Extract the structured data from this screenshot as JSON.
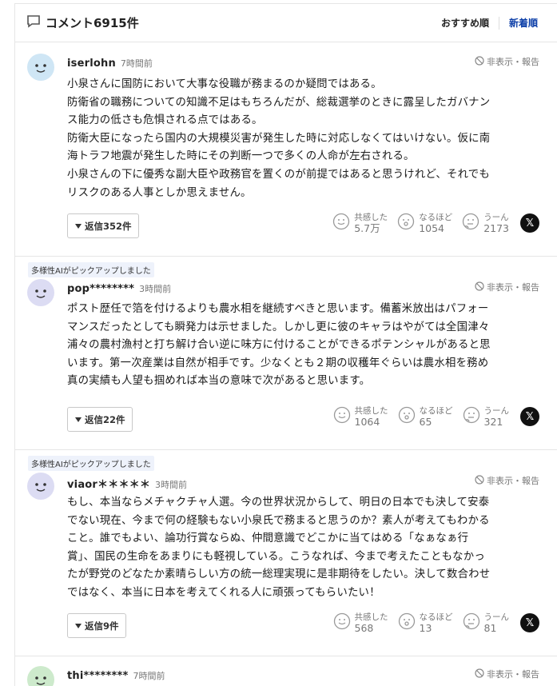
{
  "header": {
    "title": "コメント6915件",
    "sort_recommended": "おすすめ順",
    "sort_newest": "新着順"
  },
  "comments": [
    {
      "user": "iserlohn",
      "time": "7時間前",
      "hide": "非表示・報告",
      "text": "小泉さんに国防において大事な役職が務まるのか疑問ではある。\n防衛省の職務についての知識不足はもちろんだが、総裁選挙のときに露呈したガバナン\nス能力の低さも危惧される点ではある。\n防衛大臣になったら国内の大規模災害が発生した時に対応しなくてはいけない。仮に南\n海トラフ地震が発生した時にその判断一つで多くの人命が左右される。\n小泉さんの下に優秀な副大臣や政務官を置くのが前提ではあると思うけれど、それでも\nリスクのある人事としか思えません。",
      "reply": "返信352件",
      "empathy_label": "共感した",
      "empathy_count": "5.7万",
      "naruhodo_label": "なるほど",
      "naruhodo_count": "1054",
      "uun_label": "うーん",
      "uun_count": "2173",
      "avatar_color": "#cfe6f5"
    },
    {
      "badge": "多様性AIがピックアップしました",
      "user": "pop********",
      "time": "3時間前",
      "hide": "非表示・報告",
      "text": "ポスト歴任で箔を付けるよりも農水相を継続すべきと思います。備蓄米放出はパフォー\nマンスだったとしても瞬発力は示せました。しかし更に彼のキャラはやがては全国津々\n浦々の農村漁村と打ち解け合い逆に味方に付けることができるポテンシャルがあると思\nいます。第一次産業は自然が相手です。少なくとも２期の収穫年ぐらいは農水相を務め\n真の実績も人望も掴めれば本当の意味で次があると思います。",
      "reply": "返信22件",
      "empathy_label": "共感した",
      "empathy_count": "1064",
      "naruhodo_label": "なるほど",
      "naruhodo_count": "65",
      "uun_label": "うーん",
      "uun_count": "321",
      "avatar_color": "#dcdcf3"
    },
    {
      "badge": "多様性AIがピックアップしました",
      "user": "viaor＊＊＊＊＊",
      "time": "3時間前",
      "hide": "非表示・報告",
      "text": "もし、本当ならメチャクチャ人選。今の世界状況からして、明日の日本でも決して安泰\nでない現在、今まで何の経験もない小泉氏で務まると思うのか？素人が考えてもわかる\nこと。誰でもよい、論功行賞ならぬ、仲間意識でどこかに当てはめる「なぁなぁ行\n賞」、国民の生命をあまりにも軽視している。こうなれば、今まで考えたこともなかっ\nたが野党のどなたか素晴らしい方の統一総理実現に是非期待をしたい。決して数合わせ\nではなく、本当に日本を考えてくれる人に頑張ってもらいたい！",
      "reply": "返信9件",
      "empathy_label": "共感した",
      "empathy_count": "568",
      "naruhodo_label": "なるほど",
      "naruhodo_count": "13",
      "uun_label": "うーん",
      "uun_count": "81",
      "avatar_color": "#dcdcf3"
    },
    {
      "user": "thi********",
      "time": "7時間前",
      "hide": "非表示・報告",
      "avatar_color": "#cdeacc"
    }
  ],
  "icons": {
    "comment": "speech-bubble-icon",
    "hide": "block-icon",
    "reply_toggle": "triangle-down-icon",
    "empathy": "smile-face-icon",
    "naruhodo": "surprised-face-icon",
    "uun": "thinking-face-icon",
    "share": "x-logo-icon"
  }
}
